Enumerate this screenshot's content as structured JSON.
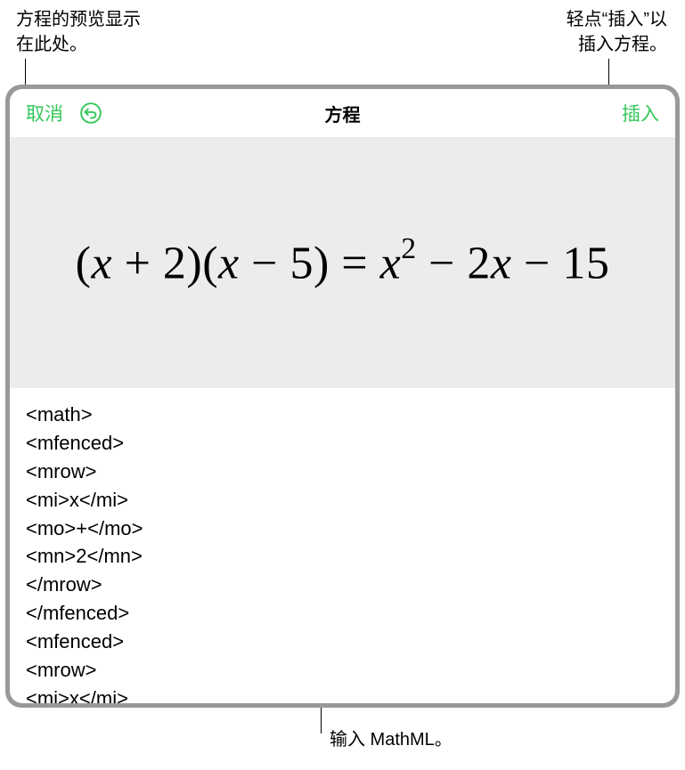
{
  "callouts": {
    "top_left": "方程的预览显示\n在此处。",
    "top_right": "轻点“插入”以\n插入方程。",
    "bottom": "输入 MathML。"
  },
  "toolbar": {
    "cancel": "取消",
    "title": "方程",
    "insert": "插入"
  },
  "preview": {
    "equation_display": "(x + 2)(x − 5) = x² − 2x − 15"
  },
  "mathml_code": "<math>\n   <mfenced>\n      <mrow>\n         <mi>x</mi>\n         <mo>+</mo>\n         <mn>2</mn>\n      </mrow>\n   </mfenced>\n   <mfenced>\n      <mrow>\n         <mi>x</mi>\n         <mo>-</mo>"
}
